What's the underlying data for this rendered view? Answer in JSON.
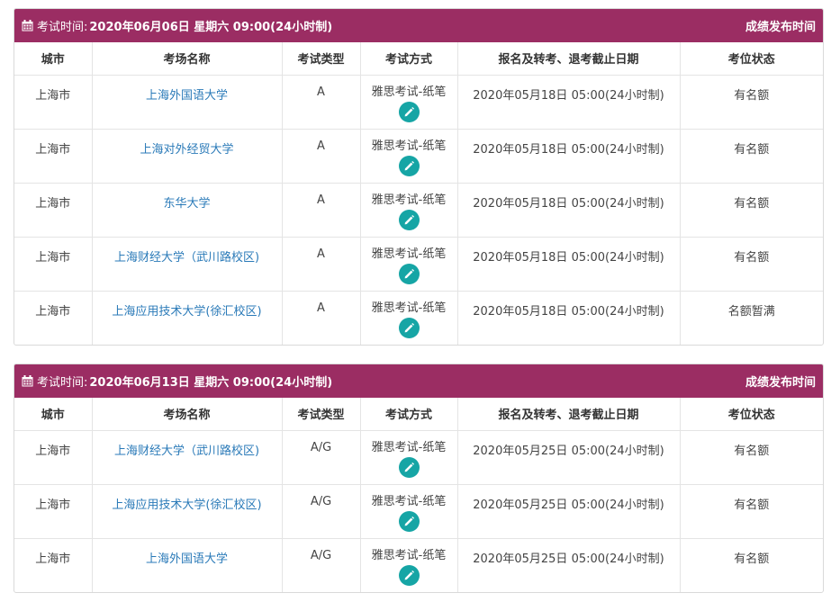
{
  "columns": [
    "城市",
    "考场名称",
    "考试类型",
    "考试方式",
    "报名及转考、退考截止日期",
    "考位状态"
  ],
  "icons": {
    "header": "calendar-icon",
    "action": "pencil-icon"
  },
  "colors": {
    "header_bg": "#9b2d63",
    "link": "#2a7ab8",
    "edit_button": "#16a5a5"
  },
  "sessions": [
    {
      "label": "考试时间:",
      "datetime": "2020年06月06日 星期六 09:00(24小时制)",
      "results_link": "成绩发布时间",
      "rows": [
        {
          "city": "上海市",
          "venue": "上海外国语大学",
          "type": "A",
          "mode": "雅思考试-纸笔",
          "deadline": "2020年05月18日 05:00(24小时制)",
          "status": "有名额"
        },
        {
          "city": "上海市",
          "venue": "上海对外经贸大学",
          "type": "A",
          "mode": "雅思考试-纸笔",
          "deadline": "2020年05月18日 05:00(24小时制)",
          "status": "有名额"
        },
        {
          "city": "上海市",
          "venue": "东华大学",
          "type": "A",
          "mode": "雅思考试-纸笔",
          "deadline": "2020年05月18日 05:00(24小时制)",
          "status": "有名额"
        },
        {
          "city": "上海市",
          "venue": "上海财经大学（武川路校区)",
          "type": "A",
          "mode": "雅思考试-纸笔",
          "deadline": "2020年05月18日 05:00(24小时制)",
          "status": "有名额"
        },
        {
          "city": "上海市",
          "venue": "上海应用技术大学(徐汇校区)",
          "type": "A",
          "mode": "雅思考试-纸笔",
          "deadline": "2020年05月18日 05:00(24小时制)",
          "status": "名额暂满"
        }
      ]
    },
    {
      "label": "考试时间:",
      "datetime": "2020年06月13日 星期六 09:00(24小时制)",
      "results_link": "成绩发布时间",
      "rows": [
        {
          "city": "上海市",
          "venue": "上海财经大学（武川路校区)",
          "type": "A/G",
          "mode": "雅思考试-纸笔",
          "deadline": "2020年05月25日 05:00(24小时制)",
          "status": "有名额"
        },
        {
          "city": "上海市",
          "venue": "上海应用技术大学(徐汇校区)",
          "type": "A/G",
          "mode": "雅思考试-纸笔",
          "deadline": "2020年05月25日 05:00(24小时制)",
          "status": "有名额"
        },
        {
          "city": "上海市",
          "venue": "上海外国语大学",
          "type": "A/G",
          "mode": "雅思考试-纸笔",
          "deadline": "2020年05月25日 05:00(24小时制)",
          "status": "有名额"
        }
      ]
    }
  ]
}
